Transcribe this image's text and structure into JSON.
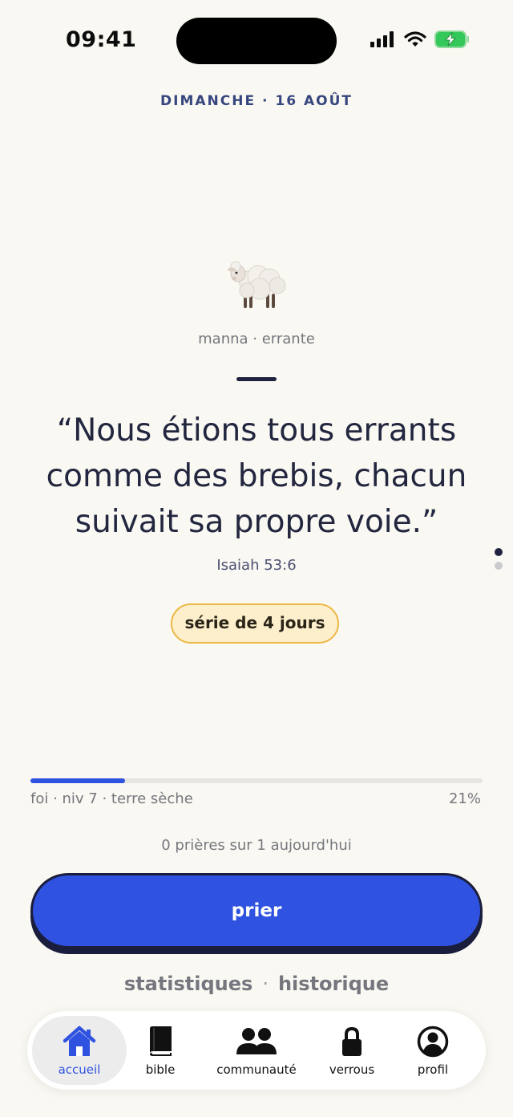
{
  "status_bar": {
    "time": "09:41",
    "icons": [
      "signal-icon",
      "wifi-icon",
      "battery-charging-icon"
    ]
  },
  "header": {
    "date": "DIMANCHE · 16 AOÛT"
  },
  "pet": {
    "emoji": "sheep",
    "label": "manna · errante"
  },
  "verse": {
    "text": "“Nous étions tous errants comme des brebis, chacun suivait sa propre voie.”",
    "reference": "Isaiah 53:6"
  },
  "page_indicator": {
    "count": 2,
    "active": 0
  },
  "streak": {
    "label": "série de 4 jours"
  },
  "progress": {
    "label": "foi · niv 7 · terre sèche",
    "percent_label": "21%",
    "fraction": 0.21
  },
  "prayer": {
    "count_text": "0 prières sur 1 aujourd'hui",
    "button_label": "prier"
  },
  "links": {
    "stats": "statistiques",
    "separator": "·",
    "history": "historique"
  },
  "tabs": [
    {
      "label": "accueil",
      "icon": "home-icon",
      "active": true
    },
    {
      "label": "bible",
      "icon": "book-icon",
      "active": false
    },
    {
      "label": "communauté",
      "icon": "people-icon",
      "active": false
    },
    {
      "label": "verrous",
      "icon": "lock-icon",
      "active": false
    },
    {
      "label": "profil",
      "icon": "profile-icon",
      "active": false
    }
  ],
  "colors": {
    "background": "#FAF8F2",
    "accent": "#2F52E0",
    "dark": "#1A1E3C",
    "streak_bg": "#FDEFCB",
    "streak_border": "#EDB845",
    "battery": "#34C759"
  }
}
